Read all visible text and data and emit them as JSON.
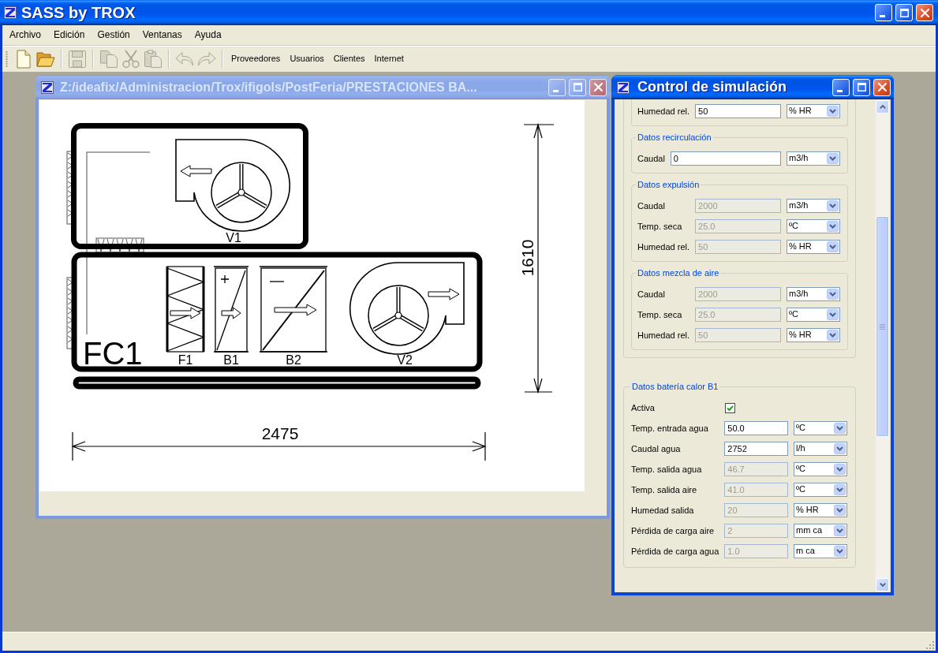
{
  "app_window": {
    "title": "SASS by TROX",
    "active": true
  },
  "menu": [
    "Archivo",
    "Edición",
    "Gestión",
    "Ventanas",
    "Ayuda"
  ],
  "toolbar": {
    "groups": [
      [
        {
          "kind": "new",
          "disabled": false
        },
        {
          "kind": "open",
          "disabled": false
        }
      ],
      [
        {
          "kind": "save",
          "disabled": true
        }
      ],
      [
        {
          "kind": "copy",
          "disabled": true
        },
        {
          "kind": "cut",
          "disabled": true
        },
        {
          "kind": "paste",
          "disabled": true
        }
      ],
      [
        {
          "kind": "undo",
          "disabled": true
        },
        {
          "kind": "redo",
          "disabled": true
        }
      ]
    ],
    "links": [
      "Proveedores",
      "Usuarios",
      "Clientes",
      "Internet"
    ]
  },
  "drawing_window": {
    "title": "Z:/ideafix/Administracion/Trox/ifigols/PostFeria/PRESTACIONES BA...",
    "active": false,
    "diagram": {
      "upper_section": [
        {
          "kind": "fan",
          "label": "V1"
        }
      ],
      "lower_section": [
        {
          "kind": "filter",
          "label": "F1"
        },
        {
          "kind": "heating_coil",
          "label": "B1"
        },
        {
          "kind": "cooling_coil",
          "label": "B2"
        },
        {
          "kind": "fan",
          "label": "V2"
        }
      ],
      "unit_label": "FC1",
      "height_dimension": "1610",
      "width_dimension": "2475"
    }
  },
  "simulation_window": {
    "title": "Control de simulación",
    "active": true,
    "groups": [
      {
        "sections": [
          {
            "rows": [
              {
                "kind": "field",
                "label": "Humedad rel.",
                "value": "50",
                "unit": "% HR",
                "disabled": false
              }
            ]
          },
          {
            "title": "Datos recirculación",
            "rows": [
              {
                "kind": "field",
                "label": "Caudal",
                "value": "0",
                "unit": "m3/h",
                "disabled": false
              }
            ]
          },
          {
            "title": "Datos expulsión",
            "rows": [
              {
                "kind": "field",
                "label": "Caudal",
                "value": "2000",
                "unit": "m3/h",
                "disabled": true
              },
              {
                "kind": "field",
                "label": "Temp. seca",
                "value": "25.0",
                "unit": "ºC",
                "disabled": true
              },
              {
                "kind": "field",
                "label": "Humedad rel.",
                "value": "50",
                "unit": "% HR",
                "disabled": true
              }
            ]
          },
          {
            "title": "Datos mezcla de aire",
            "rows": [
              {
                "kind": "field",
                "label": "Caudal",
                "value": "2000",
                "unit": "m3/h",
                "disabled": true
              },
              {
                "kind": "field",
                "label": "Temp. seca",
                "value": "25.0",
                "unit": "ºC",
                "disabled": true
              },
              {
                "kind": "field",
                "label": "Humedad rel.",
                "value": "50",
                "unit": "% HR",
                "disabled": true
              }
            ]
          }
        ]
      },
      {
        "title": "Datos batería calor B1",
        "rows": [
          {
            "kind": "checkbox",
            "label": "Activa",
            "checked": true
          },
          {
            "kind": "field",
            "label": "Temp. entrada agua",
            "value": "50.0",
            "unit": "ºC",
            "disabled": false
          },
          {
            "kind": "field",
            "label": "Caudal agua",
            "value": "2752",
            "unit": "l/h",
            "disabled": false
          },
          {
            "kind": "field",
            "label": "Temp. salida agua",
            "value": "46.7",
            "unit": "ºC",
            "disabled": true
          },
          {
            "kind": "field",
            "label": "Temp. salida aire",
            "value": "41.0",
            "unit": "ºC",
            "disabled": true
          },
          {
            "kind": "field",
            "label": "Humedad salida",
            "value": "20",
            "unit": "% HR",
            "disabled": true
          },
          {
            "kind": "field",
            "label": "Pérdida de carga aire",
            "value": "2",
            "unit": "mm ca",
            "disabled": true
          },
          {
            "kind": "field",
            "label": "Pérdida de carga agua",
            "value": "1.0",
            "unit": "m ca",
            "disabled": true
          }
        ]
      }
    ]
  }
}
